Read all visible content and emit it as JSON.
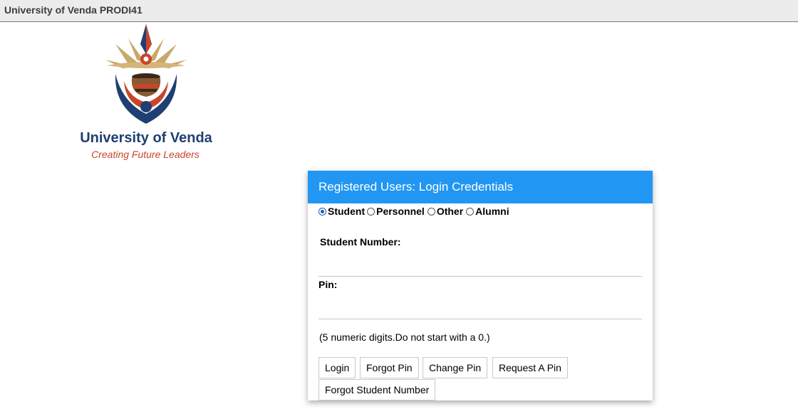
{
  "header": {
    "title": "University of Venda PRODI41"
  },
  "logo": {
    "name": "University of Venda",
    "tagline": "Creating Future Leaders"
  },
  "login": {
    "title": "Registered Users: Login Credentials",
    "roles": [
      {
        "label": "Student",
        "selected": true
      },
      {
        "label": "Personnel",
        "selected": false
      },
      {
        "label": "Other",
        "selected": false
      },
      {
        "label": "Alumni",
        "selected": false
      }
    ],
    "student_number_label": "Student Number:",
    "student_number_value": "",
    "pin_label": "Pin:",
    "pin_value": "",
    "hint": "(5 numeric digits.Do not start with a 0.)",
    "buttons": {
      "login": "Login",
      "forgot_pin": "Forgot Pin",
      "change_pin": "Change Pin",
      "request_pin": "Request A Pin",
      "forgot_student_number": "Forgot Student Number"
    }
  },
  "colors": {
    "header_blue": "#2196f3",
    "logo_navy": "#1f3f73",
    "logo_red": "#c8452a",
    "logo_gold": "#c8a96a"
  }
}
